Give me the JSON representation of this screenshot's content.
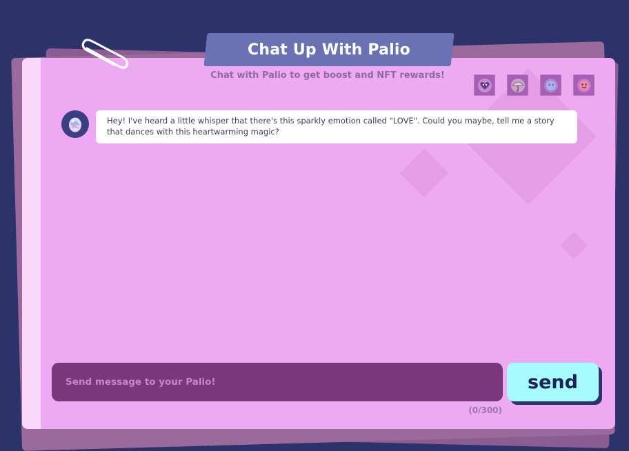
{
  "header": {
    "title": "Chat Up With Palio",
    "subtitle": "Chat with Palio to get boost and NFT rewards!"
  },
  "rewards": {
    "badges": [
      {
        "icon": "heart-face-icon"
      },
      {
        "icon": "umbrella-icon"
      },
      {
        "icon": "bubble-creature-icon"
      },
      {
        "icon": "smiling-face-icon"
      }
    ]
  },
  "chat": {
    "messages": [
      {
        "sender": "palio",
        "avatar_icon": "palio-egg-icon",
        "text": "Hey! I've heard a little whisper that there's this sparkly emotion called \"LOVE\". Could you maybe, tell me a story that dances with this heartwarming magic?"
      }
    ]
  },
  "composer": {
    "placeholder": "Send message to your Palio!",
    "value": "",
    "send_label": "send",
    "char_count": "(0/300)"
  },
  "colors": {
    "background": "#2c336a",
    "card": "#eda9f2",
    "title_tab": "#6b72b4",
    "input": "#7a387a",
    "send_button": "#a6fbff"
  }
}
